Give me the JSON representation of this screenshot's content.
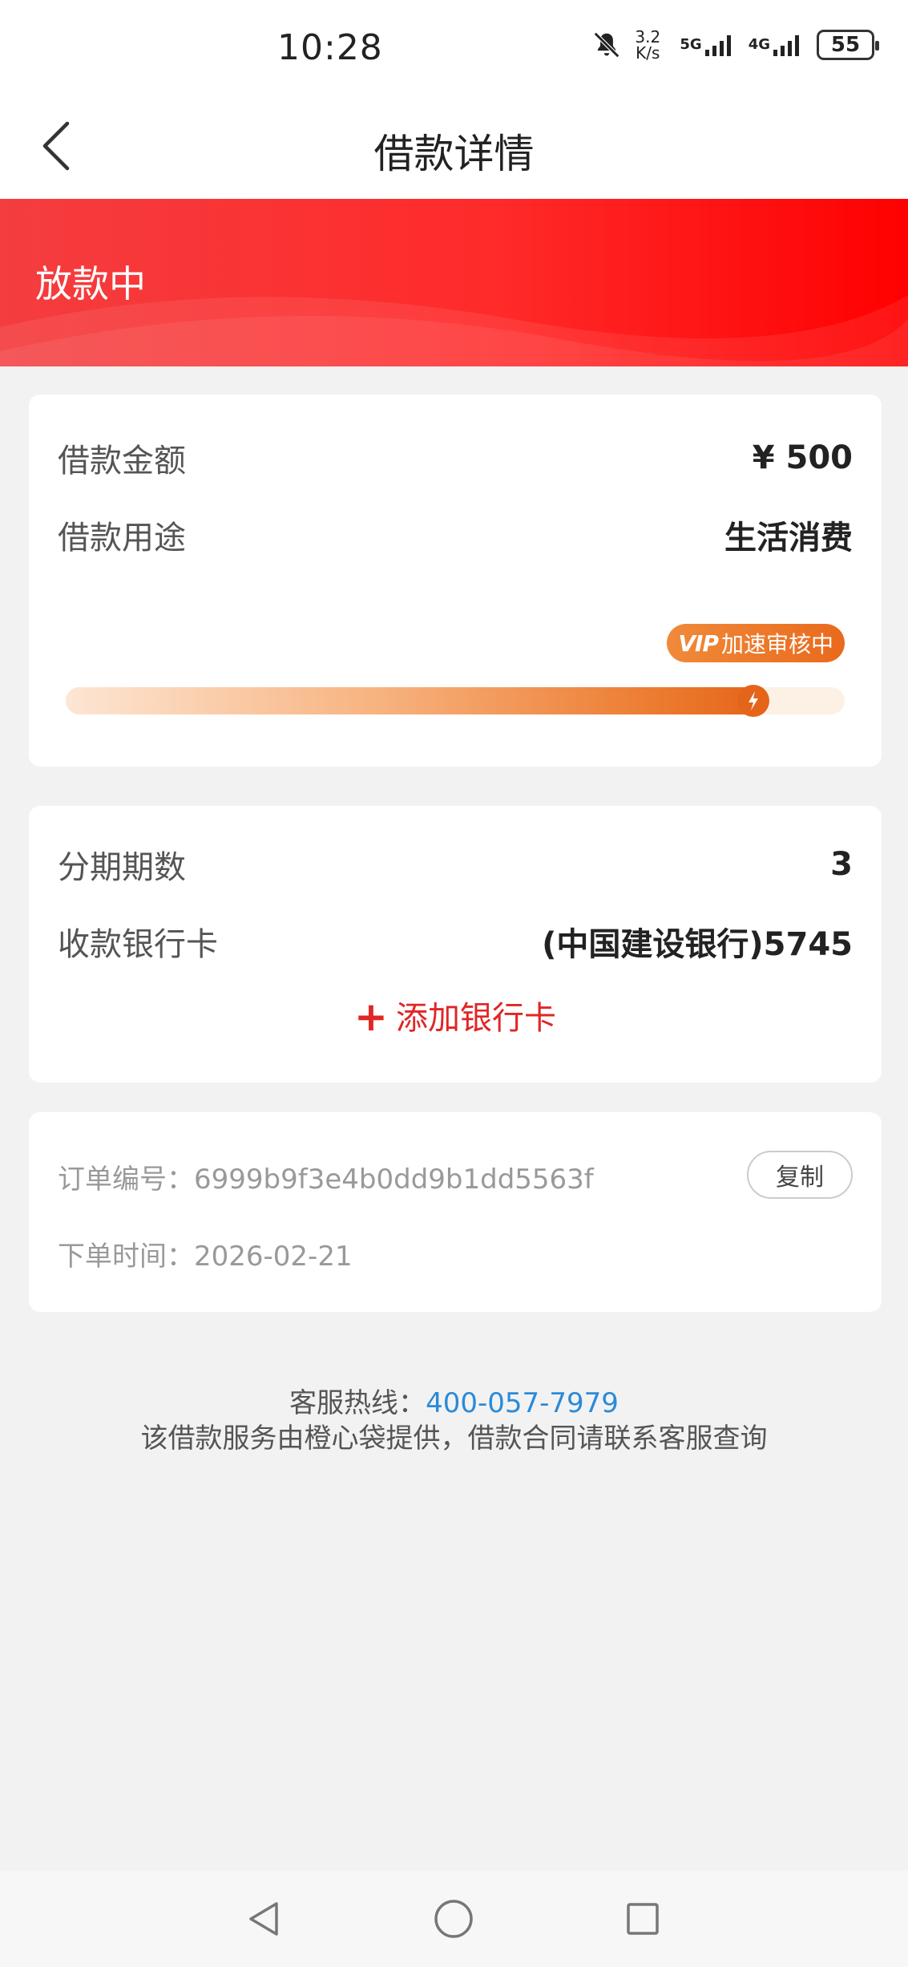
{
  "status_bar": {
    "time": "10:28",
    "net_speed_value": "3.2",
    "net_speed_unit": "K/s",
    "signal1": "5G",
    "signal2": "4G",
    "battery": "55"
  },
  "nav": {
    "title": "借款详情",
    "back_icon": "chevron-left-icon"
  },
  "banner": {
    "status": "放款中",
    "colors": [
      "#f43d3f",
      "#ff0000"
    ]
  },
  "loan": {
    "amount_label": "借款金额",
    "amount_value": "¥ 500",
    "purpose_label": "借款用途",
    "purpose_value": "生活消费",
    "vip_tag": "VIP",
    "vip_text": "加速审核中",
    "progress": 0.9
  },
  "installment": {
    "periods_label": "分期期数",
    "periods_value": "3",
    "bank_label": "收款银行卡",
    "bank_value": "(中国建设银行)5745",
    "add_card_label": "添加银行卡"
  },
  "order": {
    "number_label": "订单编号：",
    "number_value": "6999b9f3e4b0dd9b1dd5563f",
    "copy_label": "复制",
    "time_label": "下单时间：",
    "time_value": "2026-02-21"
  },
  "footer": {
    "hotline_label": "客服热线：",
    "hotline_number": "400-057-7979",
    "note": "该借款服务由橙心袋提供，借款合同请联系客服查询"
  },
  "colors": {
    "accent_red": "#e02626",
    "vip_orange": "#e96a1c",
    "link_blue": "#2a8ad8"
  },
  "system_nav": {
    "back": "triangle-back-icon",
    "home": "circle-home-icon",
    "recents": "square-recents-icon"
  }
}
